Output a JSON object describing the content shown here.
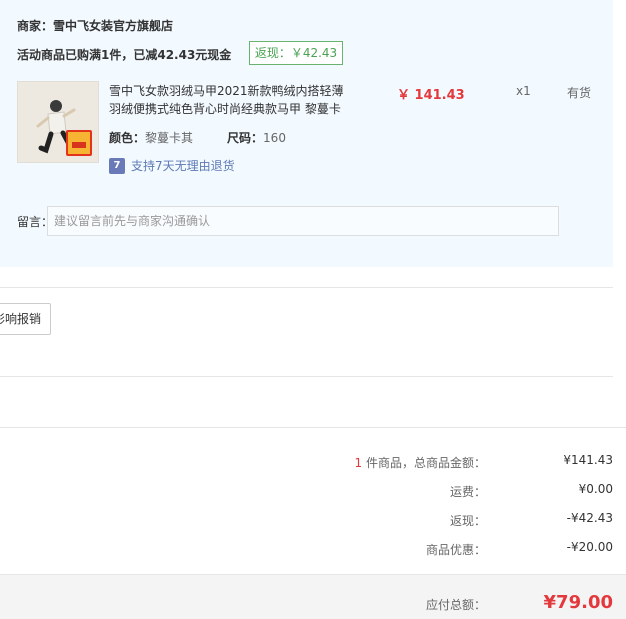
{
  "order": {
    "merchant_label": "商家：雪中飞女装官方旗舰店",
    "promo_text": "活动商品已购满1件，已减42.43元现金",
    "cashback_tag": "返现：￥42.43",
    "product": {
      "name": "雪中飞女款羽绒马甲2021新款鸭绒内搭轻薄羽绒便携式纯色背心时尚经典款马甲 黎蔓卡",
      "price": "￥ 141.43",
      "quantity": "x1",
      "stock": "有货",
      "color_label": "颜色：",
      "color_value": "黎蔓卡其",
      "size_label": "尺码：",
      "size_value": "160",
      "return_icon_text": "7",
      "return_policy": "支持7天无理由退货"
    },
    "message_label": "留言：",
    "message_placeholder": "建议留言前先与商家沟通确认"
  },
  "invoice_button_label": "影响报销",
  "summary": {
    "count_prefix": "1",
    "count_label": " 件商品，总商品金额：",
    "goods_total": "¥141.43",
    "shipping_label": "运费：",
    "shipping_value": "¥0.00",
    "cashback_label": "返现：",
    "cashback_value": "-¥42.43",
    "discount_label": "商品优惠：",
    "discount_value": "-¥20.00",
    "payable_label": "应付总额：",
    "payable_value": "¥79.00"
  },
  "colors": {
    "panel_bg": "#f2f9ff",
    "price_red": "#e4393c",
    "cashback_green": "#4aa352",
    "return_blue": "#5e7ab4"
  },
  "icons": {
    "return_badge": "seven-day-return-icon"
  }
}
